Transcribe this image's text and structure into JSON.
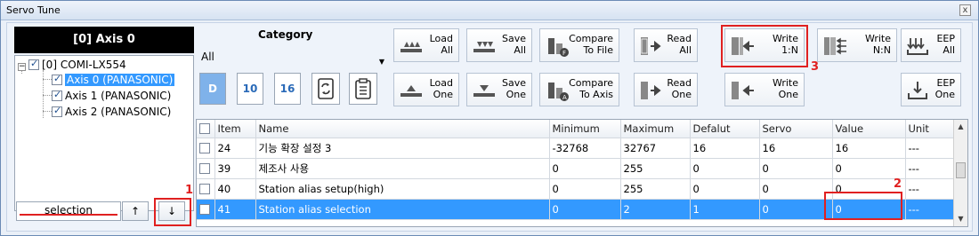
{
  "window": {
    "title": "Servo Tune",
    "close_glyph": "x"
  },
  "left": {
    "axis_header": "[0] Axis  0",
    "tree": {
      "root": "[0]  COMI-LX554",
      "items": [
        "Axis  0 (PANASONIC)",
        "Axis  1 (PANASONIC)",
        "Axis  2 (PANASONIC)"
      ]
    },
    "selection_label": "selection",
    "up_glyph": "↑",
    "down_glyph": "↓"
  },
  "category": {
    "label": "Category",
    "value": "All"
  },
  "format_buttons": [
    "D",
    "10",
    "16"
  ],
  "toolbar": {
    "load_all": "Load\nAll",
    "save_all": "Save\nAll",
    "compare_to_file": "Compare\nTo File",
    "read_all": "Read\nAll",
    "write_1n": "Write\n1:N",
    "write_nn": "Write\nN:N",
    "eep_all": "EEP\nAll",
    "load_one": "Load\nOne",
    "save_one": "Save\nOne",
    "compare_to_axis": "Compare\nTo Axis",
    "read_one": "Read\nOne",
    "write_one": "Write\nOne",
    "eep_one": "EEP\nOne"
  },
  "annotations": {
    "n1": "1",
    "n2": "2",
    "n3": "3"
  },
  "table": {
    "headers": [
      "Item",
      "Name",
      "Minimum",
      "Maximum",
      "Defalut",
      "Servo",
      "Value",
      "Unit"
    ],
    "rows": [
      {
        "item": "24",
        "name": "기능 확장 설정 3",
        "min": "-32768",
        "max": "32767",
        "def": "16",
        "servo": "16",
        "value": "16",
        "unit": "---",
        "selected": false
      },
      {
        "item": "39",
        "name": "제조사 사용",
        "min": "0",
        "max": "255",
        "def": "0",
        "servo": "0",
        "value": "0",
        "unit": "---",
        "selected": false
      },
      {
        "item": "40",
        "name": "Station alias setup(high)",
        "min": "0",
        "max": "255",
        "def": "0",
        "servo": "0",
        "value": "0",
        "unit": "---",
        "selected": false
      },
      {
        "item": "41",
        "name": "Station alias selection",
        "min": "0",
        "max": "2",
        "def": "1",
        "servo": "0",
        "value": "0",
        "unit": "---",
        "selected": true
      }
    ]
  },
  "colors": {
    "selection": "#3399ff",
    "annotation": "#e02020",
    "header": "#000000"
  }
}
